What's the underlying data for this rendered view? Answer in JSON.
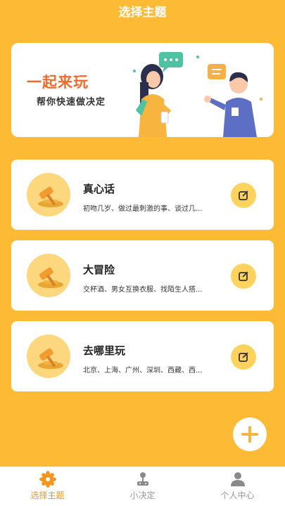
{
  "header": {
    "title": "选择主题"
  },
  "banner": {
    "title": "一起来玩",
    "subtitle": "帮你快速做决定"
  },
  "topics": [
    {
      "title": "真心话",
      "desc": "初吻几岁、做过最刺激的事、谈过几..."
    },
    {
      "title": "大冒险",
      "desc": "交杯酒、男女互换衣服、找陌生人搭..."
    },
    {
      "title": "去哪里玩",
      "desc": "北京、上海、广州、深圳、西藏、西..."
    }
  ],
  "tabbar": {
    "items": [
      {
        "label": "选择主题",
        "icon": "flower-icon",
        "active": true
      },
      {
        "label": "小决定",
        "icon": "joystick-icon",
        "active": false
      },
      {
        "label": "个人中心",
        "icon": "person-icon",
        "active": false
      }
    ]
  },
  "colors": {
    "background": "#FDBA35",
    "accent": "#F7941D",
    "banner_title": "#F26A2B"
  }
}
